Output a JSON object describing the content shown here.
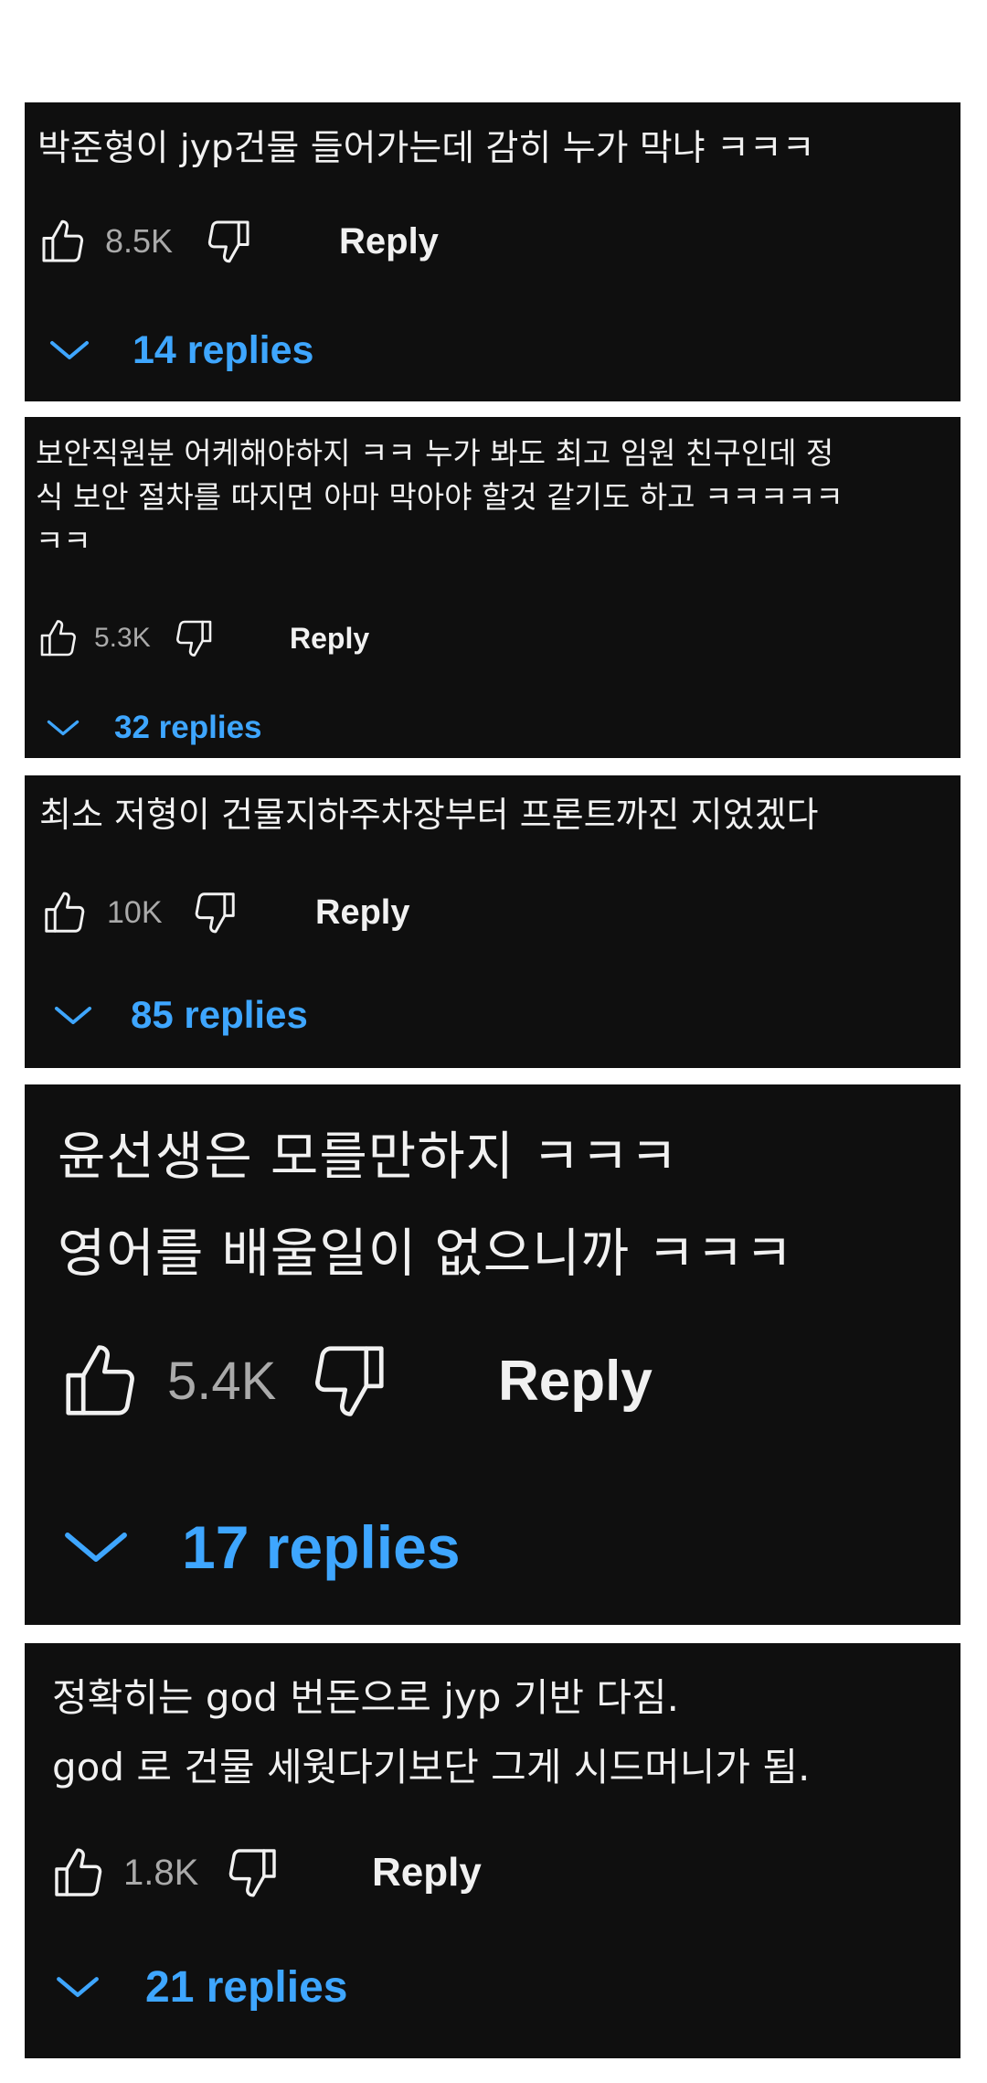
{
  "colors": {
    "card_background": "#0f0f0f",
    "text": "#f1f1f1",
    "count_text": "#aaaaaa",
    "replies_link": "#3ea6ff"
  },
  "comments": [
    {
      "text": "박준형이 jyp건물 들어가는데 감히 누가 막냐 ㅋㅋㅋ",
      "like_count": "8.5K",
      "reply_label": "Reply",
      "replies_label": "14 replies",
      "icons": [
        "thumb-up-icon",
        "thumb-down-icon",
        "chevron-down-icon"
      ]
    },
    {
      "text": "보안직원분 어케해야하지 ㅋㅋ 누가 봐도 최고 임원 친구인데 정\n식 보안 절차를 따지면 아마 막아야 할것 같기도 하고 ㅋㅋㅋㅋㅋ\nㅋㅋ",
      "like_count": "5.3K",
      "reply_label": "Reply",
      "replies_label": "32 replies",
      "icons": [
        "thumb-up-icon",
        "thumb-down-icon",
        "chevron-down-icon"
      ]
    },
    {
      "text": "최소 저형이 건물지하주차장부터 프론트까진 지었겠다",
      "like_count": "10K",
      "reply_label": "Reply",
      "replies_label": "85 replies",
      "icons": [
        "thumb-up-icon",
        "thumb-down-icon",
        "chevron-down-icon"
      ]
    },
    {
      "text": "윤선생은 모를만하지 ㅋㅋㅋ\n영어를 배울일이 없으니까 ㅋㅋㅋ",
      "like_count": "5.4K",
      "reply_label": "Reply",
      "replies_label": "17 replies",
      "icons": [
        "thumb-up-icon",
        "thumb-down-icon",
        "chevron-down-icon"
      ]
    },
    {
      "text": "정확히는 god 번돈으로 jyp 기반 다짐.\ngod 로 건물 세웟다기보단 그게 시드머니가 됨.",
      "like_count": "1.8K",
      "reply_label": "Reply",
      "replies_label": "21 replies",
      "icons": [
        "thumb-up-icon",
        "thumb-down-icon",
        "chevron-down-icon"
      ]
    }
  ]
}
